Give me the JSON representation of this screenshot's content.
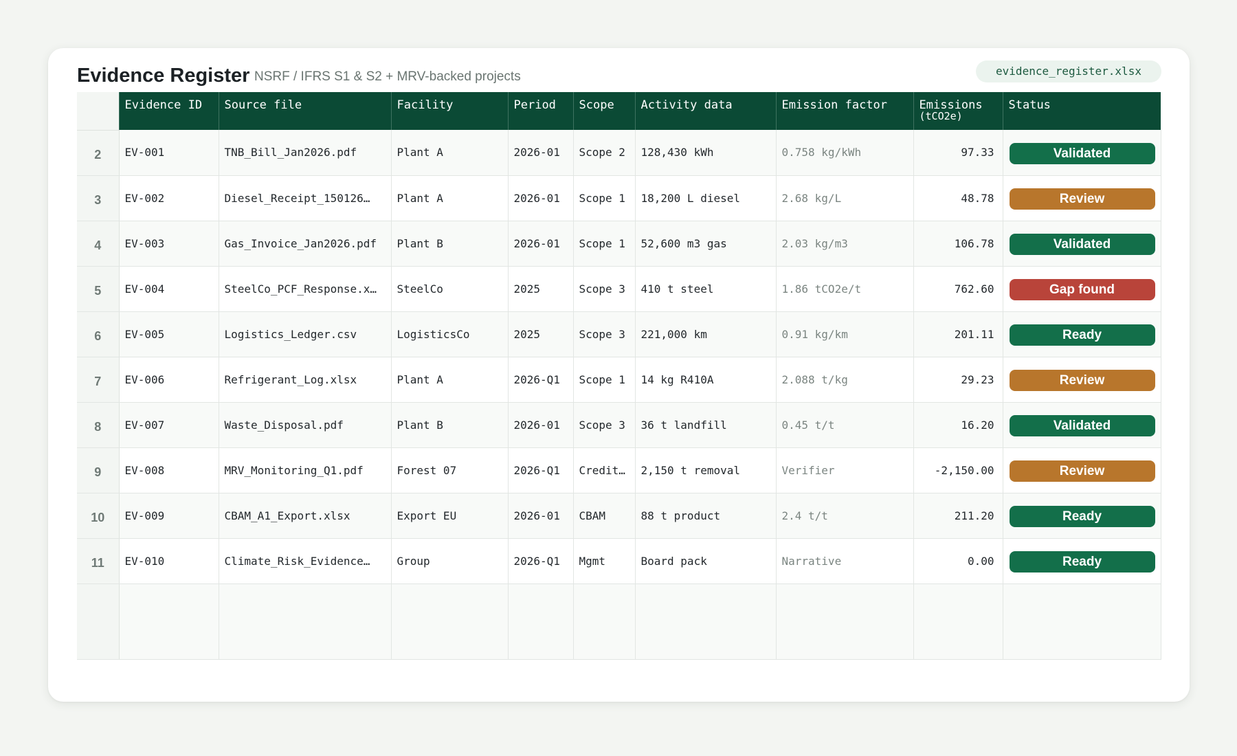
{
  "header": {
    "title": "Evidence Register",
    "subtitle": "NSRF / IFRS S1 & S2 + MRV-backed projects",
    "file_name": "evidence_register.xlsx"
  },
  "table": {
    "columns": {
      "evidence_id": "Evidence ID",
      "source_file": "Source file",
      "facility": "Facility",
      "period": "Period",
      "scope": "Scope",
      "activity": "Activity data",
      "factor": "Emission factor",
      "emissions": "Emissions",
      "emissions_unit": "(tCO2e)",
      "status": "Status"
    },
    "rows": [
      {
        "row": "2",
        "id": "EV-001",
        "file": "TNB_Bill_Jan2026.pdf",
        "facility": "Plant A",
        "period": "2026-01",
        "scope": "Scope 2",
        "activity": "128,430 kWh",
        "factor": "0.758 kg/kWh",
        "emissions": "97.33",
        "status": "Validated",
        "status_kind": "validated"
      },
      {
        "row": "3",
        "id": "EV-002",
        "file": "Diesel_Receipt_150126…",
        "facility": "Plant A",
        "period": "2026-01",
        "scope": "Scope 1",
        "activity": "18,200 L diesel",
        "factor": "2.68 kg/L",
        "emissions": "48.78",
        "status": "Review",
        "status_kind": "review"
      },
      {
        "row": "4",
        "id": "EV-003",
        "file": "Gas_Invoice_Jan2026.pdf",
        "facility": "Plant B",
        "period": "2026-01",
        "scope": "Scope 1",
        "activity": "52,600 m3 gas",
        "factor": "2.03 kg/m3",
        "emissions": "106.78",
        "status": "Validated",
        "status_kind": "validated"
      },
      {
        "row": "5",
        "id": "EV-004",
        "file": "SteelCo_PCF_Response.x…",
        "facility": "SteelCo",
        "period": "2025",
        "scope": "Scope 3",
        "activity": "410 t steel",
        "factor": "1.86 tCO2e/t",
        "emissions": "762.60",
        "status": "Gap found",
        "status_kind": "gap"
      },
      {
        "row": "6",
        "id": "EV-005",
        "file": "Logistics_Ledger.csv",
        "facility": "LogisticsCo",
        "period": "2025",
        "scope": "Scope 3",
        "activity": "221,000 km",
        "factor": "0.91 kg/km",
        "emissions": "201.11",
        "status": "Ready",
        "status_kind": "ready"
      },
      {
        "row": "7",
        "id": "EV-006",
        "file": "Refrigerant_Log.xlsx",
        "facility": "Plant A",
        "period": "2026-Q1",
        "scope": "Scope 1",
        "activity": "14 kg R410A",
        "factor": "2.088 t/kg",
        "emissions": "29.23",
        "status": "Review",
        "status_kind": "review"
      },
      {
        "row": "8",
        "id": "EV-007",
        "file": "Waste_Disposal.pdf",
        "facility": "Plant B",
        "period": "2026-01",
        "scope": "Scope 3",
        "activity": "36 t landfill",
        "factor": "0.45 t/t",
        "emissions": "16.20",
        "status": "Validated",
        "status_kind": "validated"
      },
      {
        "row": "9",
        "id": "EV-008",
        "file": "MRV_Monitoring_Q1.pdf",
        "facility": "Forest 07",
        "period": "2026-Q1",
        "scope": "Credit…",
        "activity": "2,150 t removal",
        "factor": "Verifier",
        "emissions": "-2,150.00",
        "status": "Review",
        "status_kind": "review"
      },
      {
        "row": "10",
        "id": "EV-009",
        "file": "CBAM_A1_Export.xlsx",
        "facility": "Export EU",
        "period": "2026-01",
        "scope": "CBAM",
        "activity": "88 t product",
        "factor": "2.4 t/t",
        "emissions": "211.20",
        "status": "Ready",
        "status_kind": "ready"
      },
      {
        "row": "11",
        "id": "EV-010",
        "file": "Climate_Risk_Evidence…",
        "facility": "Group",
        "period": "2026-Q1",
        "scope": "Mgmt",
        "activity": "Board pack",
        "factor": "Narrative",
        "emissions": "0.00",
        "status": "Ready",
        "status_kind": "ready"
      }
    ]
  }
}
